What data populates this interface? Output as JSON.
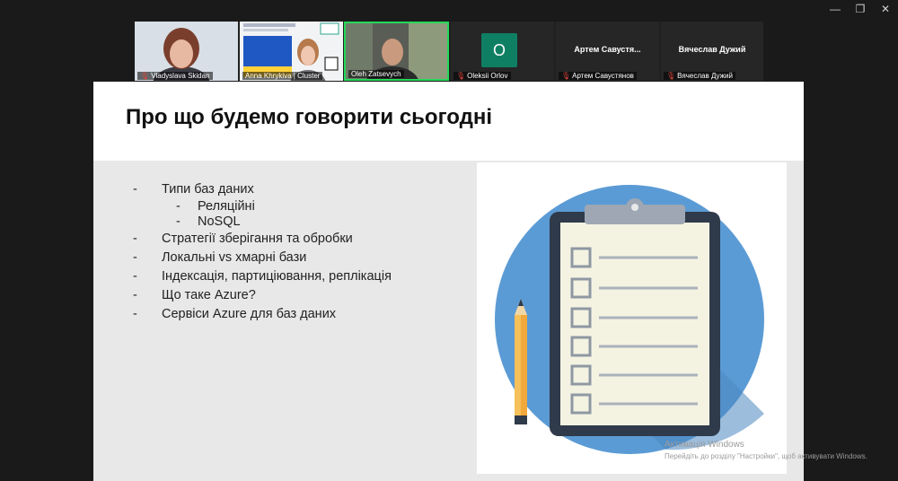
{
  "window": {
    "controls": [
      "—",
      "❐",
      "✕"
    ]
  },
  "participants": [
    {
      "name": "Vladyslava Skidan",
      "muted": true
    },
    {
      "name": "Anna Khrykivа | Cluster",
      "muted": false
    },
    {
      "name": "Oleh Zatsevych",
      "muted": false
    },
    {
      "name": "Oleksii Orlov",
      "muted": true,
      "initial": "O"
    },
    {
      "name": "Артем Савустянов",
      "muted": true,
      "display_name": "Артем Савустя..."
    },
    {
      "name": "Вячеслав Дужий",
      "muted": true,
      "display_name": "Вячеслав Дужий"
    }
  ],
  "slide": {
    "title": "Про що будемо говорити сьогодні",
    "bullets": [
      "Типи баз даних",
      "Реляційні",
      "NoSQL",
      "Стратегії зберігання та обробки",
      "Локальні vs хмарні бази",
      "Індексація, партиціювання, реплікація",
      "Що таке Azure?",
      "Сервіси Azure для баз даних"
    ],
    "dash": "-",
    "illustration": {
      "type": "clipboard-checklist",
      "circle_color": "#5b9bd5",
      "board_color": "#f4f3e2"
    }
  },
  "watermark": {
    "line1": "Активація Windows",
    "line2": "Перейдіть до розділу \"Настройки\", щоб активувати Windows."
  }
}
